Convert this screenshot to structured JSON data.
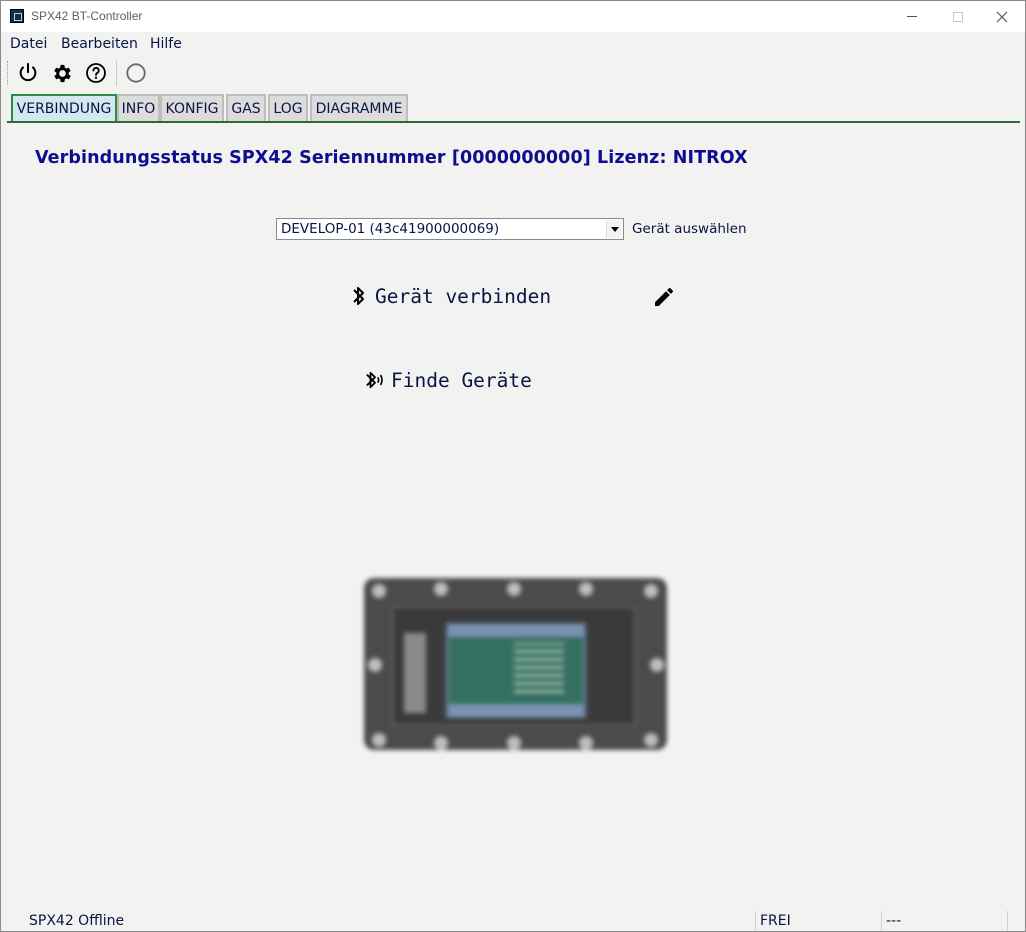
{
  "window": {
    "title": "SPX42 BT-Controller",
    "accent_color": "#2e8b3a"
  },
  "menu": {
    "items": [
      {
        "label": "Datei"
      },
      {
        "label": "Bearbeiten"
      },
      {
        "label": "Hilfe"
      }
    ]
  },
  "toolbar": {
    "buttons": [
      {
        "icon": "power-icon"
      },
      {
        "icon": "gear-icon"
      },
      {
        "icon": "help-icon"
      },
      {
        "icon": "spinner-icon"
      }
    ]
  },
  "tabs": [
    {
      "label": "VERBINDUNG",
      "active": true
    },
    {
      "label": "INFO",
      "active": false
    },
    {
      "label": "KONFIG",
      "active": false
    },
    {
      "label": "GAS",
      "active": false
    },
    {
      "label": "LOG",
      "active": false
    },
    {
      "label": "DIAGRAMME",
      "active": false
    }
  ],
  "main": {
    "heading": "Verbindungsstatus SPX42 Seriennummer [0000000000] Lizenz: NITROX",
    "device_select": {
      "value": "DEVELOP-01 (43c41900000069)",
      "label": "Gerät auswählen"
    },
    "connect_label": "Gerät verbinden",
    "find_label": "Finde Geräte",
    "heading_color": "#0d0d8e"
  },
  "statusbar": {
    "state": "SPX42 Offline",
    "mode": "FREI",
    "extra": "---"
  }
}
